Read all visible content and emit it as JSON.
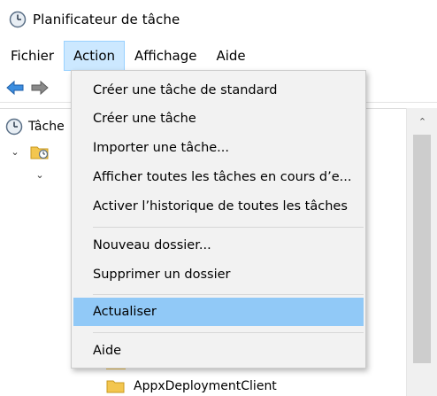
{
  "window": {
    "title": "Planificateur de tâche"
  },
  "menubar": {
    "items": [
      "Fichier",
      "Action",
      "Affichage",
      "Aide"
    ],
    "active_index": 1
  },
  "tree": {
    "root_label": "Tâche",
    "child_folder_label": "AppxDeploymentClient"
  },
  "dropdown": {
    "items": [
      "Créer une tâche de standard",
      "Créer une tâche",
      "Importer une tâche...",
      "Afficher toutes les tâches en cours d’e...",
      "Activer l’historique de toutes les tâches",
      "Nouveau dossier...",
      "Supprimer un dossier",
      "Actualiser",
      "Aide"
    ],
    "highlighted_index": 7
  },
  "colors": {
    "menu_active_bg": "#cce8ff",
    "highlight_bg": "#91c9f7",
    "dropdown_bg": "#f2f2f2"
  },
  "icons": {
    "app": "clock-icon",
    "back": "back-arrow-icon",
    "forward": "forward-arrow-icon",
    "folder": "folder-icon"
  }
}
